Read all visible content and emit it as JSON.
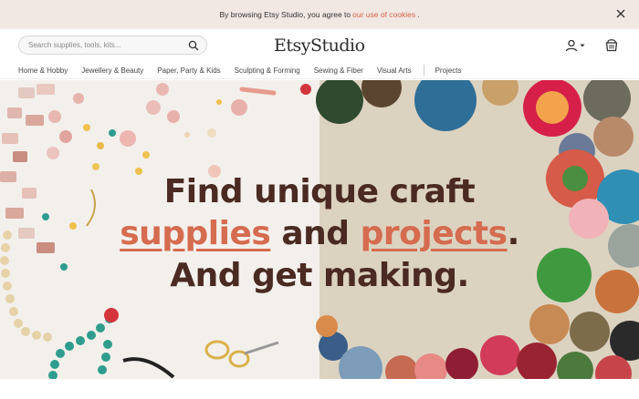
{
  "cookie_bar": {
    "text_before": "By browsing Etsy Studio, you agree to",
    "link": "our use of cookies",
    "text_after": "."
  },
  "header": {
    "logo_main": "Etsy",
    "logo_sub": "Studio",
    "search_placeholder": "Search supplies, tools, kits..."
  },
  "nav": {
    "items": [
      "Home & Hobby",
      "Jewellery & Beauty",
      "Paper, Party & Kids",
      "Sculpting & Forming",
      "Sewing & Fiber",
      "Visual Arts"
    ],
    "projects": "Projects"
  },
  "hero": {
    "line1": "Find unique craft",
    "line2_link1": "supplies",
    "line2_mid": "and",
    "line2_link2": "projects",
    "line2_end": ".",
    "line3": "And get making."
  },
  "colors": {
    "accent": "#d56b4f",
    "headline": "#4a2a22",
    "cookie_bg": "#f1e7e3"
  }
}
